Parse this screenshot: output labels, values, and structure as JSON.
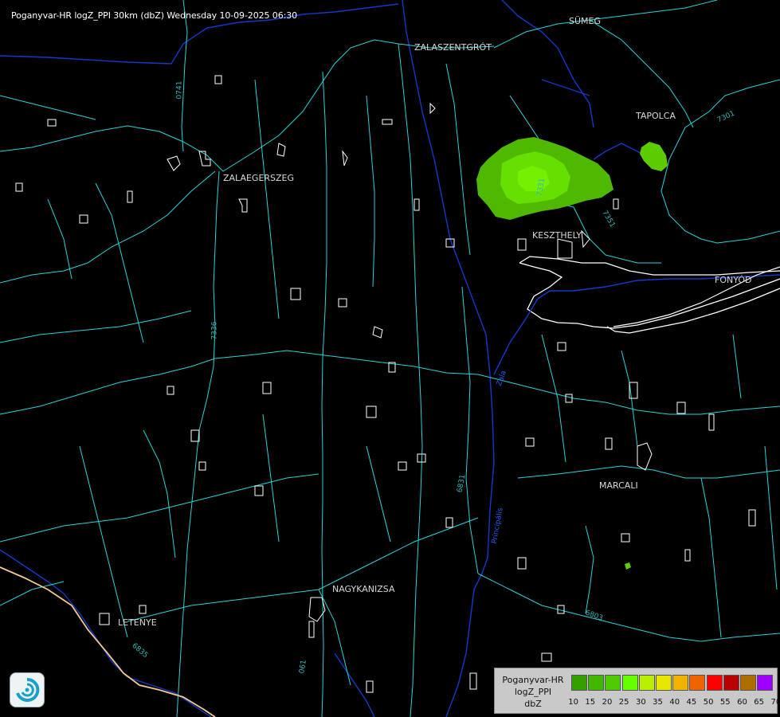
{
  "header": {
    "title": "Poganyvar-HR logZ_PPI 30km (dbZ) Wednesday 10-09-2025 06:30"
  },
  "cities": [
    "SÜMEG",
    "ZALASZENTGRÓT",
    "TAPOLCA",
    "ZALAEGERSZEG",
    "KESZTHELY",
    "FONYÓD",
    "MARCALI",
    "NAGYKANIZSA",
    "LETENYE"
  ],
  "roads": [
    "0741",
    "7336",
    "7331",
    "7351",
    "7301",
    "6803",
    "6831",
    "6835",
    "061"
  ],
  "rivers": [
    "Zala",
    "Principális"
  ],
  "legend": {
    "title_lines": [
      "Poganyvar-HR",
      "logZ_PPI",
      "dbZ"
    ],
    "ticks": [
      "10",
      "15",
      "20",
      "25",
      "30",
      "35",
      "40",
      "45",
      "50",
      "55",
      "60",
      "65",
      "70"
    ],
    "colors": [
      "#33a000",
      "#40b800",
      "#4fcc00",
      "#66ff00",
      "#b9f000",
      "#e6e600",
      "#f0b400",
      "#f06400",
      "#ff0000",
      "#bb0000",
      "#b06e00",
      "#a000ff",
      "#c0c0ff"
    ]
  },
  "logo_icon": "radar-swirl-icon"
}
